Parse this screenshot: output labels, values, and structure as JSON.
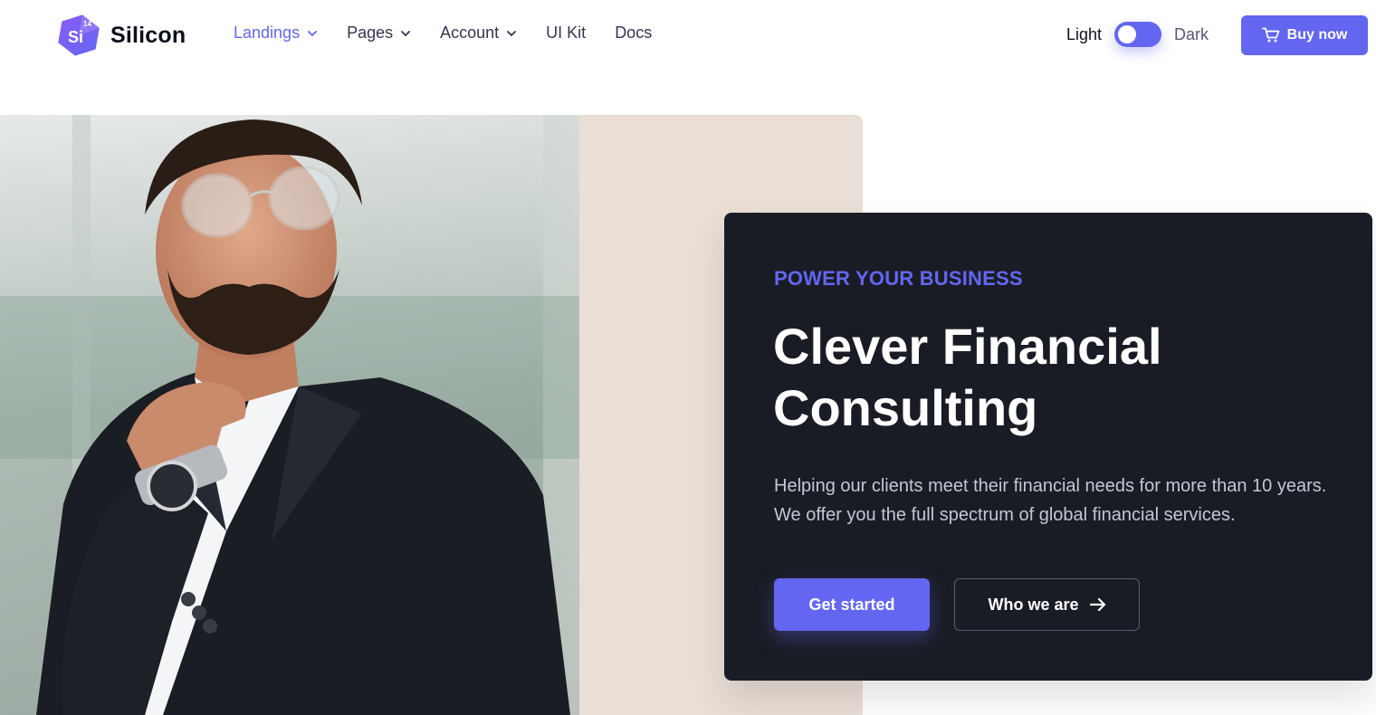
{
  "brand": {
    "name": "Silicon",
    "badge": "14",
    "logo_letters": "Si",
    "accent_color": "#6366f1"
  },
  "nav": {
    "items": [
      {
        "label": "Landings",
        "has_dropdown": true,
        "active": true
      },
      {
        "label": "Pages",
        "has_dropdown": true,
        "active": false
      },
      {
        "label": "Account",
        "has_dropdown": true,
        "active": false
      },
      {
        "label": "UI Kit",
        "has_dropdown": false,
        "active": false
      },
      {
        "label": "Docs",
        "has_dropdown": false,
        "active": false
      }
    ]
  },
  "theme_switch": {
    "light_label": "Light",
    "dark_label": "Dark",
    "mode": "light"
  },
  "header": {
    "buy_label": "Buy now",
    "buy_icon": "cart-icon"
  },
  "hero": {
    "image": "businessman-portrait",
    "eyebrow": "POWER YOUR BUSINESS",
    "title_line1": "Clever Financial",
    "title_line2": "Consulting",
    "description": "Helping our clients meet their financial needs for more than 10 years. We offer you the full spectrum of global financial services.",
    "primary_cta": "Get started",
    "secondary_cta": "Who we are",
    "secondary_icon": "arrow-right-icon",
    "card_color": "#1a1c25"
  }
}
